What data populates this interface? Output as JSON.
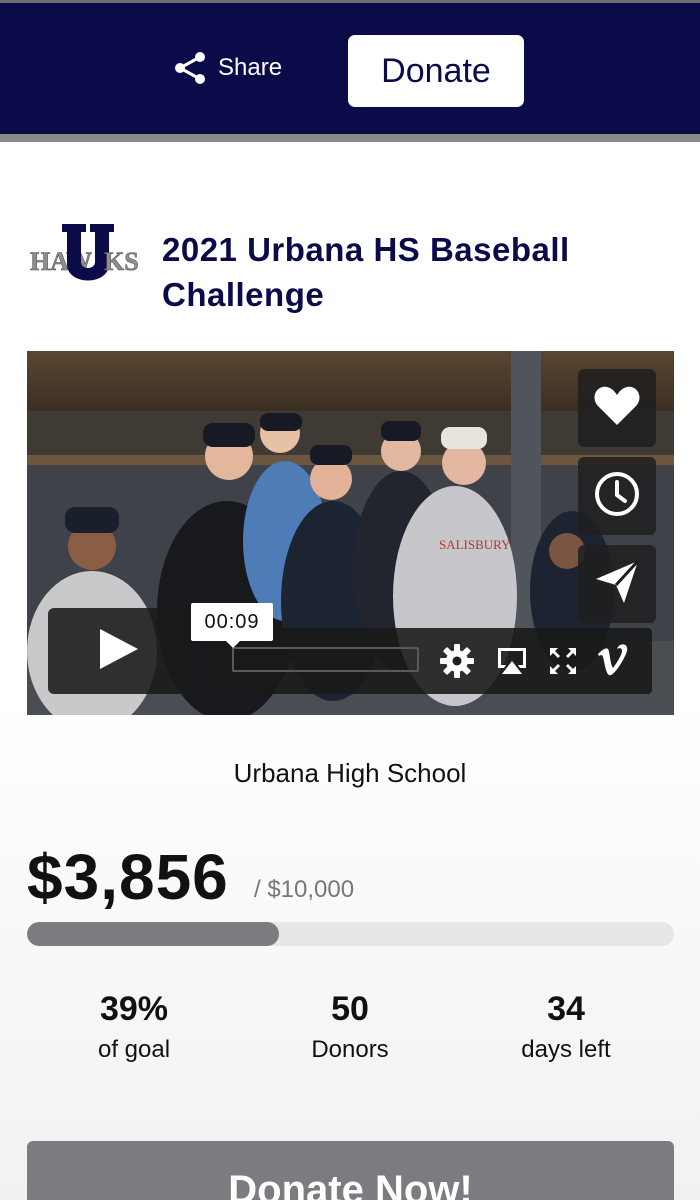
{
  "header": {
    "share_label": "Share",
    "donate_label": "Donate"
  },
  "campaign": {
    "logo_text_left": "HAW",
    "logo_text_right": "KS",
    "logo_letter": "U",
    "title": "2021 Urbana HS Baseball Challenge",
    "organization": "Urbana High School"
  },
  "video": {
    "timecode": "00:09",
    "jersey_text": "SALISBURY",
    "side_buttons": [
      "heart-icon",
      "clock-icon",
      "send-icon"
    ],
    "controls": [
      "settings-icon",
      "airplay-icon",
      "fullscreen-icon",
      "vimeo-icon"
    ]
  },
  "funding": {
    "raised": "$3,856",
    "goal": "/ $10,000",
    "progress_fraction": 0.39
  },
  "stats": [
    {
      "value": "39%",
      "label": "of goal"
    },
    {
      "value": "50",
      "label": "Donors"
    },
    {
      "value": "34",
      "label": "days left"
    }
  ],
  "cta": {
    "label": "Donate Now!"
  },
  "colors": {
    "navy": "#0b0b4a",
    "gray_button": "#7c7b80"
  }
}
